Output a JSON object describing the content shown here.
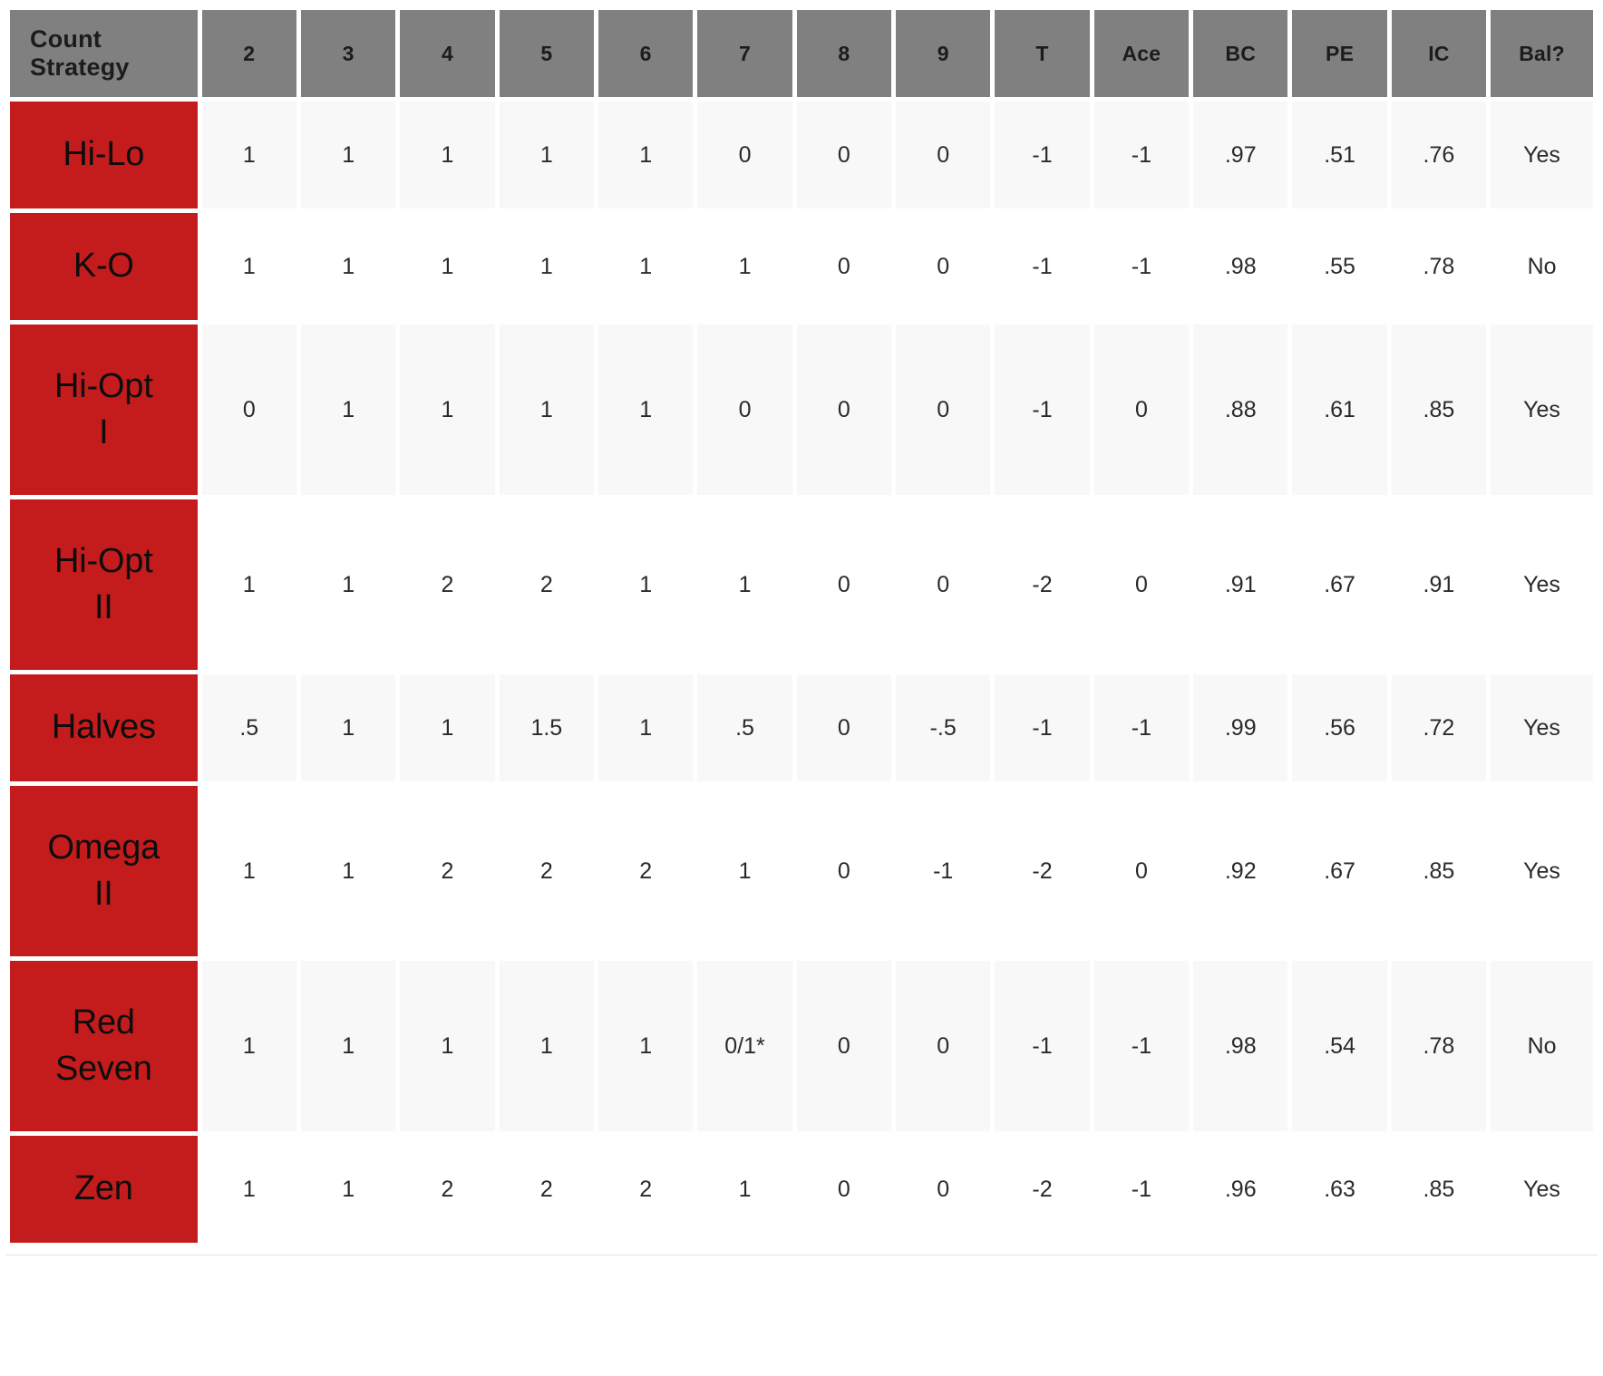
{
  "table": {
    "corner_header": "Count Strategy",
    "corner_header_line1": "Count",
    "corner_header_line2": "Strategy",
    "columns": [
      {
        "key": "two",
        "label": "2"
      },
      {
        "key": "three",
        "label": "3"
      },
      {
        "key": "four",
        "label": "4"
      },
      {
        "key": "five",
        "label": "5"
      },
      {
        "key": "six",
        "label": "6"
      },
      {
        "key": "seven",
        "label": "7"
      },
      {
        "key": "eight",
        "label": "8"
      },
      {
        "key": "nine",
        "label": "9"
      },
      {
        "key": "ten",
        "label": "T"
      },
      {
        "key": "ace",
        "label": "Ace"
      },
      {
        "key": "bc",
        "label": "BC"
      },
      {
        "key": "pe",
        "label": "PE"
      },
      {
        "key": "ic",
        "label": "IC"
      },
      {
        "key": "bal",
        "label": "Bal?"
      }
    ],
    "rows": [
      {
        "name": "Hi-Lo",
        "name_line1": "Hi-Lo",
        "name_line2": "",
        "values": [
          "1",
          "1",
          "1",
          "1",
          "1",
          "0",
          "0",
          "0",
          "-1",
          "-1",
          ".97",
          ".51",
          ".76",
          "Yes"
        ]
      },
      {
        "name": "K-O",
        "name_line1": "K-O",
        "name_line2": "",
        "values": [
          "1",
          "1",
          "1",
          "1",
          "1",
          "1",
          "0",
          "0",
          "-1",
          "-1",
          ".98",
          ".55",
          ".78",
          "No"
        ]
      },
      {
        "name": "Hi-Opt I",
        "name_line1": "Hi-Opt",
        "name_line2": "I",
        "values": [
          "0",
          "1",
          "1",
          "1",
          "1",
          "0",
          "0",
          "0",
          "-1",
          "0",
          ".88",
          ".61",
          ".85",
          "Yes"
        ]
      },
      {
        "name": "Hi-Opt II",
        "name_line1": "Hi-Opt",
        "name_line2": "II",
        "values": [
          "1",
          "1",
          "2",
          "2",
          "1",
          "1",
          "0",
          "0",
          "-2",
          "0",
          ".91",
          ".67",
          ".91",
          "Yes"
        ]
      },
      {
        "name": "Halves",
        "name_line1": "Halves",
        "name_line2": "",
        "values": [
          ".5",
          "1",
          "1",
          "1.5",
          "1",
          ".5",
          "0",
          "-.5",
          "-1",
          "-1",
          ".99",
          ".56",
          ".72",
          "Yes"
        ]
      },
      {
        "name": "Omega II",
        "name_line1": "Omega",
        "name_line2": "II",
        "values": [
          "1",
          "1",
          "2",
          "2",
          "2",
          "1",
          "0",
          "-1",
          "-2",
          "0",
          ".92",
          ".67",
          ".85",
          "Yes"
        ]
      },
      {
        "name": "Red Seven",
        "name_line1": "Red",
        "name_line2": "Seven",
        "values": [
          "1",
          "1",
          "1",
          "1",
          "1",
          "0/1*",
          "0",
          "0",
          "-1",
          "-1",
          ".98",
          ".54",
          ".78",
          "No"
        ]
      },
      {
        "name": "Zen",
        "name_line1": "Zen",
        "name_line2": "",
        "values": [
          "1",
          "1",
          "2",
          "2",
          "2",
          "1",
          "0",
          "0",
          "-2",
          "-1",
          ".96",
          ".63",
          ".85",
          "Yes"
        ]
      }
    ]
  },
  "colors": {
    "header_gray": "#808080",
    "strategy_red": "#c41c1c",
    "row_tint": "#f8f8f8",
    "text_dark": "#2a2a2a"
  },
  "chart_data": {
    "type": "table",
    "title": "Count Strategy card tag values and performance metrics",
    "columns": [
      "Count Strategy",
      "2",
      "3",
      "4",
      "5",
      "6",
      "7",
      "8",
      "9",
      "T",
      "Ace",
      "BC",
      "PE",
      "IC",
      "Bal?"
    ],
    "rows": [
      [
        "Hi-Lo",
        "1",
        "1",
        "1",
        "1",
        "1",
        "0",
        "0",
        "0",
        "-1",
        "-1",
        ".97",
        ".51",
        ".76",
        "Yes"
      ],
      [
        "K-O",
        "1",
        "1",
        "1",
        "1",
        "1",
        "1",
        "0",
        "0",
        "-1",
        "-1",
        ".98",
        ".55",
        ".78",
        "No"
      ],
      [
        "Hi-Opt I",
        "0",
        "1",
        "1",
        "1",
        "1",
        "0",
        "0",
        "0",
        "-1",
        "0",
        ".88",
        ".61",
        ".85",
        "Yes"
      ],
      [
        "Hi-Opt II",
        "1",
        "1",
        "2",
        "2",
        "1",
        "1",
        "0",
        "0",
        "-2",
        "0",
        ".91",
        ".67",
        ".91",
        "Yes"
      ],
      [
        "Halves",
        ".5",
        "1",
        "1",
        "1.5",
        "1",
        ".5",
        "0",
        "-.5",
        "-1",
        "-1",
        ".99",
        ".56",
        ".72",
        "Yes"
      ],
      [
        "Omega II",
        "1",
        "1",
        "2",
        "2",
        "2",
        "1",
        "0",
        "-1",
        "-2",
        "0",
        ".92",
        ".67",
        ".85",
        "Yes"
      ],
      [
        "Red Seven",
        "1",
        "1",
        "1",
        "1",
        "1",
        "0/1*",
        "0",
        "0",
        "-1",
        "-1",
        ".98",
        ".54",
        ".78",
        "No"
      ],
      [
        "Zen",
        "1",
        "1",
        "2",
        "2",
        "2",
        "1",
        "0",
        "0",
        "-2",
        "-1",
        ".96",
        ".63",
        ".85",
        "Yes"
      ]
    ]
  }
}
